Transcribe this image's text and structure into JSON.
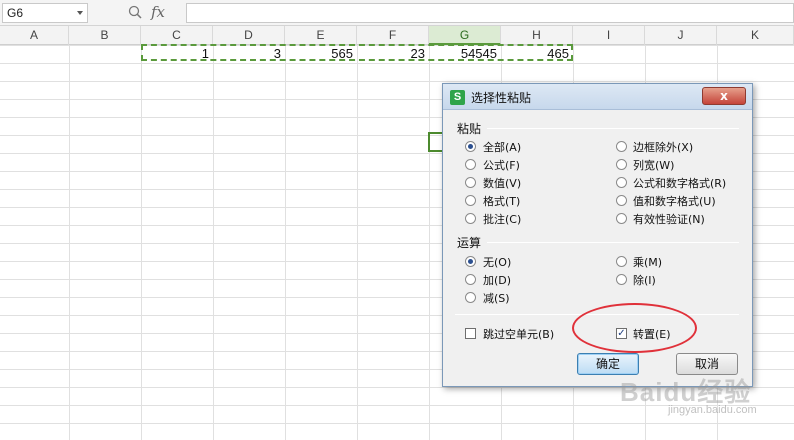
{
  "formula_bar": {
    "name_box": "G6",
    "fx_label": "fx",
    "formula": ""
  },
  "columns": [
    {
      "label": "A",
      "selected": false
    },
    {
      "label": "B",
      "selected": false
    },
    {
      "label": "C",
      "selected": false
    },
    {
      "label": "D",
      "selected": false
    },
    {
      "label": "E",
      "selected": false
    },
    {
      "label": "F",
      "selected": false
    },
    {
      "label": "G",
      "selected": true
    },
    {
      "label": "H",
      "selected": false
    },
    {
      "label": "I",
      "selected": false
    },
    {
      "label": "J",
      "selected": false
    },
    {
      "label": "K",
      "selected": false
    }
  ],
  "row1_values": {
    "C": "1",
    "D": "3",
    "E": "565",
    "F": "23",
    "G": "54545",
    "H": "465"
  },
  "dialog": {
    "title": "选择性粘贴",
    "logo_letter": "S",
    "close_label": "x",
    "paste_section": "粘贴",
    "paste_options": [
      {
        "label": "全部(A)",
        "selected": true
      },
      {
        "label": "公式(F)",
        "selected": false
      },
      {
        "label": "数值(V)",
        "selected": false
      },
      {
        "label": "格式(T)",
        "selected": false
      },
      {
        "label": "批注(C)",
        "selected": false
      },
      {
        "label": "边框除外(X)",
        "selected": false
      },
      {
        "label": "列宽(W)",
        "selected": false
      },
      {
        "label": "公式和数字格式(R)",
        "selected": false
      },
      {
        "label": "值和数字格式(U)",
        "selected": false
      },
      {
        "label": "有效性验证(N)",
        "selected": false
      }
    ],
    "operation_section": "运算",
    "operation_options": [
      {
        "label": "无(O)",
        "selected": true
      },
      {
        "label": "加(D)",
        "selected": false
      },
      {
        "label": "减(S)",
        "selected": false
      },
      {
        "label": "乘(M)",
        "selected": false
      },
      {
        "label": "除(I)",
        "selected": false
      }
    ],
    "skip_blanks": {
      "label": "跳过空单元(B)",
      "checked": false
    },
    "transpose": {
      "label": "转置(E)",
      "checked": true
    },
    "ok_label": "确定",
    "cancel_label": "取消"
  },
  "watermark": {
    "main": "Baidu经验",
    "sub": "jingyan.baidu.com"
  },
  "colors": {
    "selection_green": "#5a9a3c",
    "annotation_red": "#e0313a",
    "ok_blue": "#3c7fb1"
  }
}
